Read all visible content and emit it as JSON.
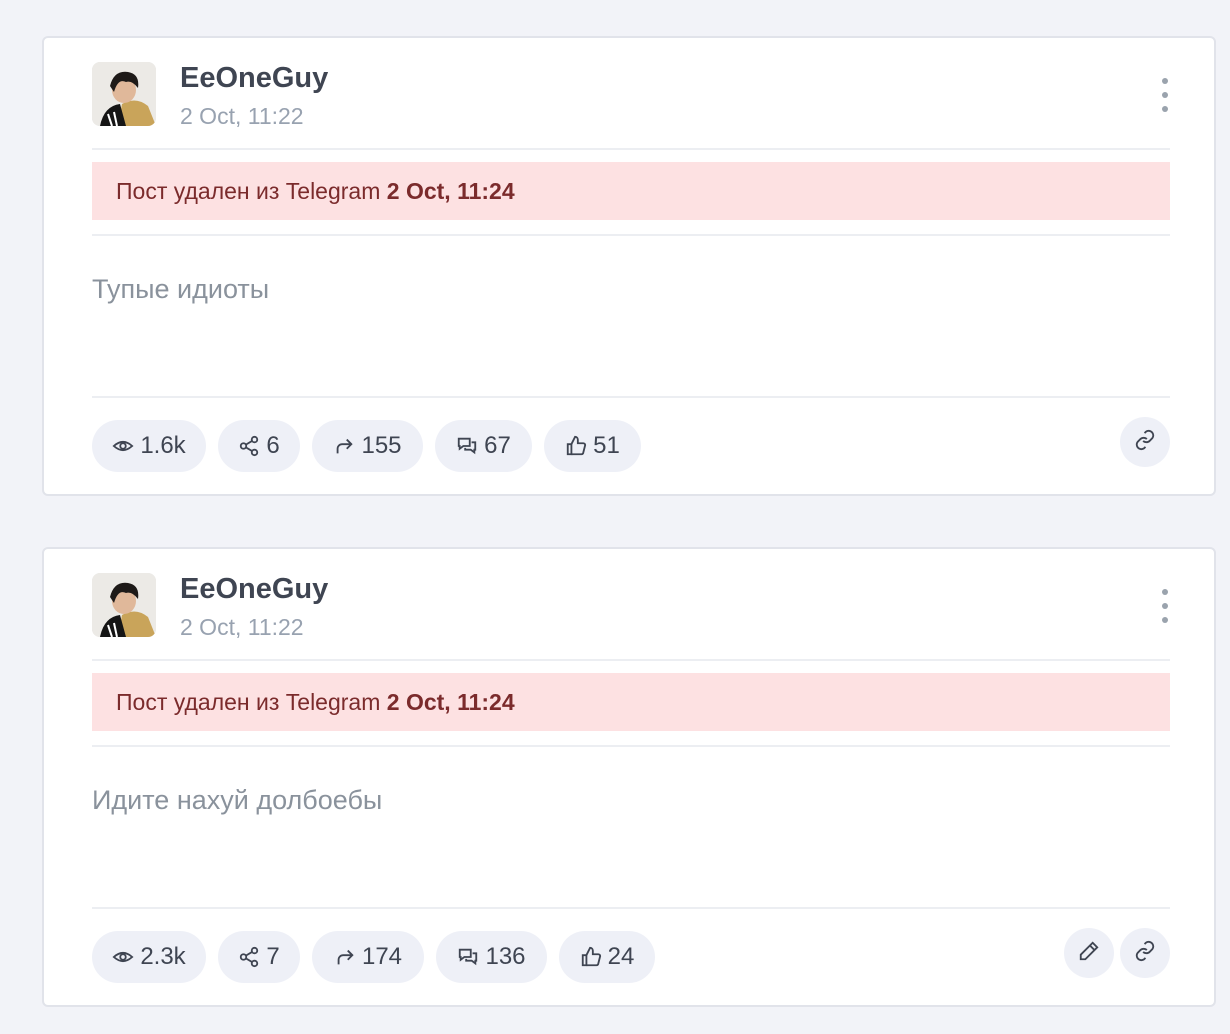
{
  "posts": [
    {
      "author": "EeOneGuy",
      "date": "2 Oct, 11:22",
      "deleted_prefix": "Пост удален из Telegram",
      "deleted_time": "2 Oct, 11:24",
      "text": "Тупые идиоты",
      "stats": {
        "views": "1.6k",
        "shares": "6",
        "forwards": "155",
        "comments": "67",
        "likes": "51"
      },
      "actions": [
        "link-icon"
      ]
    },
    {
      "author": "EeOneGuy",
      "date": "2 Oct, 11:22",
      "deleted_prefix": "Пост удален из Telegram",
      "deleted_time": "2 Oct, 11:24",
      "text": "Идите нахуй долбоебы",
      "stats": {
        "views": "2.3k",
        "shares": "7",
        "forwards": "174",
        "comments": "136",
        "likes": "24"
      },
      "actions": [
        "pencil-icon",
        "link-icon"
      ]
    }
  ],
  "colors": {
    "page_background": "#f2f3f8",
    "card_background": "#ffffff",
    "alert_background": "#fde1e2",
    "alert_text": "#7b2b2c",
    "pill_background": "#eef0f7",
    "muted_text": "#98a2b0"
  }
}
